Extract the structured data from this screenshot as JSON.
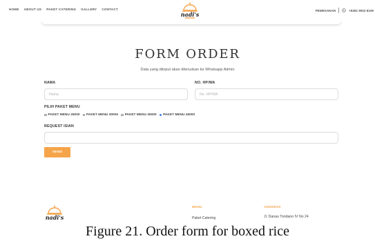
{
  "nav": {
    "items": [
      "HOME",
      "ABOUT US",
      "PAKET CATERING",
      "GALLERY",
      "CONTACT"
    ],
    "pemesanan": "PEMESANAN",
    "phone": "+6281 9910 8109"
  },
  "brand": {
    "name": "nadi's",
    "accent": "#f5a44a"
  },
  "form": {
    "title": "FORM ORDER",
    "subtitle": "Data yang diinput akan diteruskan ke Whatsapp Admin",
    "nama_label": "NAMA",
    "nama_placeholder": "Nama",
    "hp_label": "NO. HP/WA",
    "hp_placeholder": "No. HP/WA",
    "paket_label": "PILIH PAKET MENU",
    "paket_options": [
      "PAKET MENU 25000",
      "PAKET MENU 30000",
      "PAKET MENU 35000",
      "PAKET MENU 45000"
    ],
    "paket_selected": "PAKET MENU 45000",
    "request_label": "REQUEST ISIAN",
    "request_value": "",
    "send_label": "SEND"
  },
  "footer": {
    "menu_heading": "MENU",
    "menu_item": "Paket Catering",
    "address_heading": "ADDRESS",
    "address_text": "Jl. Danau Tondano IV No 24"
  },
  "caption": "Figure 21. Order form for boxed rice"
}
